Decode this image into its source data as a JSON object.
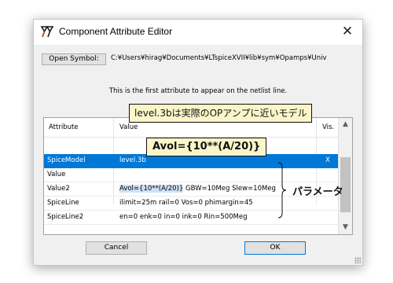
{
  "window": {
    "title": "Component Attribute Editor",
    "close_glyph": "✕",
    "icon": "ltspice-app-icon"
  },
  "toolbar": {
    "open_symbol_label": "Open Symbol:",
    "symbol_path": "C:¥Users¥hirag¥Documents¥LTspiceXVII¥lib¥sym¥Opamps¥Univ"
  },
  "info_text": "This is the first attribute to appear on the netlist line.",
  "table": {
    "columns": [
      "Attribute",
      "Value",
      "Vis."
    ],
    "rows": [
      {
        "attribute": "SpiceModel",
        "value": "level.3b",
        "vis": "X"
      },
      {
        "attribute": "Value",
        "value": "",
        "vis": ""
      },
      {
        "attribute": "Value2",
        "value_highlight": "Avol={10**(A/20)}",
        "value_rest": " GBW=10Meg Slew=10Meg",
        "vis": ""
      },
      {
        "attribute": "SpiceLine",
        "value": "ilimit=25m rail=0 Vos=0 phimargin=45",
        "vis": ""
      },
      {
        "attribute": "SpiceLine2",
        "value": "en=0 enk=0 in=0 ink=0 Rin=500Meg",
        "vis": ""
      }
    ],
    "selected_row": 0
  },
  "buttons": {
    "cancel": "Cancel",
    "ok": "OK"
  },
  "annotations": {
    "model_callout": "level.3bは実際のOPアンプに近いモデル",
    "avol_callout": "Avol={10**(A/20)}",
    "param_label": "パラメータ"
  },
  "colors": {
    "selection": "#0078d7",
    "callout_bg": "#fbf6c9"
  }
}
